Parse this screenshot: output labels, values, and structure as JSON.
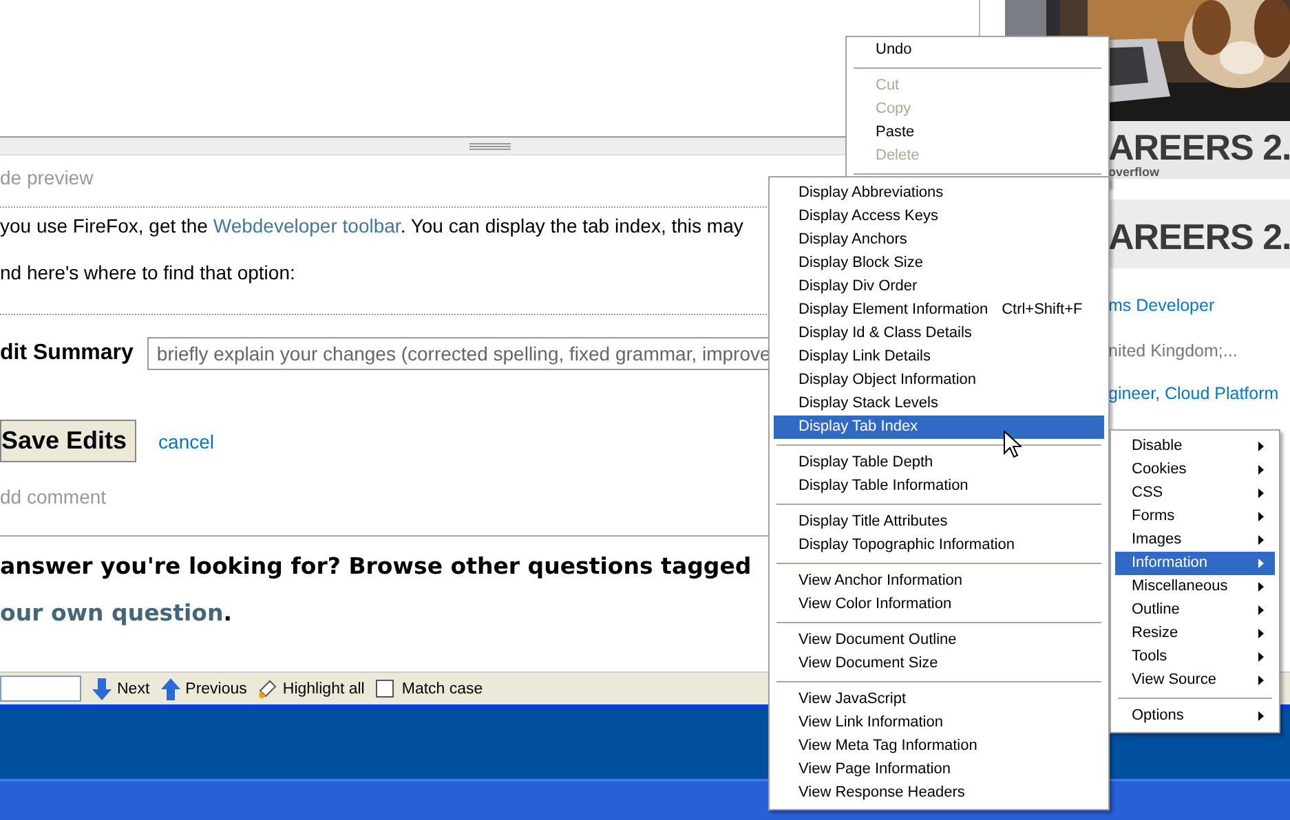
{
  "editor": {
    "preview_label": "de preview",
    "paragraph_1": {
      "before": "you use FireFox, get the ",
      "link": "Webdeveloper toolbar",
      "after": ". You can display the tab index, this may"
    },
    "paragraph_2": "nd here's where to find that option:",
    "summary_label": "dit Summary",
    "summary_placeholder": "briefly explain your changes (corrected spelling, fixed grammar, improve",
    "save_button": "Save Edits",
    "cancel_link": "cancel",
    "add_comment": "dd comment"
  },
  "footer_question": {
    "text": "answer you're looking for? Browse other questions tagged",
    "link": "our own question",
    "after": "."
  },
  "find_bar": {
    "next": "Next",
    "previous": "Previous",
    "highlight_all": "Highlight all",
    "match_case": {
      "label": "Match case",
      "checked": false
    }
  },
  "sidebar": {
    "banners": [
      {
        "title": "AREERS 2.",
        "subtitle": "overflow"
      },
      {
        "title": "AREERS 2."
      }
    ],
    "jobs": [
      {
        "text": "ms Developer",
        "kind": "link"
      },
      {
        "text": "nited Kingdom;...",
        "kind": "location"
      },
      {
        "text": "gineer, Cloud Platform",
        "kind": "link"
      }
    ]
  },
  "edit_menu": {
    "groups": [
      [
        {
          "label": "Undo",
          "disabled": false
        }
      ],
      [
        {
          "label": "Cut",
          "disabled": true
        },
        {
          "label": "Copy",
          "disabled": true
        },
        {
          "label": "Paste",
          "disabled": false
        },
        {
          "label": "Delete",
          "disabled": true
        }
      ]
    ]
  },
  "information_menu": {
    "groups": [
      [
        {
          "label": "Display Abbreviations",
          "selected": false
        },
        {
          "label": "Display Access Keys",
          "selected": false
        },
        {
          "label": "Display Anchors",
          "selected": false
        },
        {
          "label": "Display Block Size",
          "selected": false
        },
        {
          "label": "Display Div Order",
          "selected": false
        },
        {
          "label": "Display Element Information",
          "shortcut": "Ctrl+Shift+F",
          "selected": false
        },
        {
          "label": "Display Id & Class Details",
          "selected": false
        },
        {
          "label": "Display Link Details",
          "selected": false
        },
        {
          "label": "Display Object Information",
          "selected": false
        },
        {
          "label": "Display Stack Levels",
          "selected": false
        },
        {
          "label": "Display Tab Index",
          "selected": true
        }
      ],
      [
        {
          "label": "Display Table Depth",
          "selected": false
        },
        {
          "label": "Display Table Information",
          "selected": false
        }
      ],
      [
        {
          "label": "Display Title Attributes",
          "selected": false
        },
        {
          "label": "Display Topographic Information",
          "selected": false
        }
      ],
      [
        {
          "label": "View Anchor Information",
          "selected": false
        },
        {
          "label": "View Color Information",
          "selected": false
        }
      ],
      [
        {
          "label": "View Document Outline",
          "selected": false
        },
        {
          "label": "View Document Size",
          "selected": false
        }
      ],
      [
        {
          "label": "View JavaScript",
          "selected": false
        },
        {
          "label": "View Link Information",
          "selected": false
        },
        {
          "label": "View Meta Tag Information",
          "selected": false
        },
        {
          "label": "View Page Information",
          "selected": false
        },
        {
          "label": "View Response Headers",
          "selected": false
        }
      ]
    ]
  },
  "webdeveloper_menu": {
    "groups": [
      [
        {
          "label": "Disable",
          "kind": "submenu",
          "selected": false
        },
        {
          "label": "Cookies",
          "kind": "submenu",
          "selected": false
        },
        {
          "label": "CSS",
          "kind": "submenu",
          "selected": false
        },
        {
          "label": "Forms",
          "kind": "submenu",
          "selected": false
        },
        {
          "label": "Images",
          "kind": "submenu",
          "selected": false
        },
        {
          "label": "Information",
          "kind": "submenu",
          "selected": true
        },
        {
          "label": "Miscellaneous",
          "kind": "submenu",
          "selected": false
        },
        {
          "label": "Outline",
          "kind": "submenu",
          "selected": false
        },
        {
          "label": "Resize",
          "kind": "submenu",
          "selected": false
        },
        {
          "label": "Tools",
          "kind": "submenu",
          "selected": false
        },
        {
          "label": "View Source",
          "kind": "submenu",
          "selected": false
        }
      ],
      [
        {
          "label": "Options",
          "kind": "submenu",
          "selected": false
        }
      ]
    ]
  }
}
